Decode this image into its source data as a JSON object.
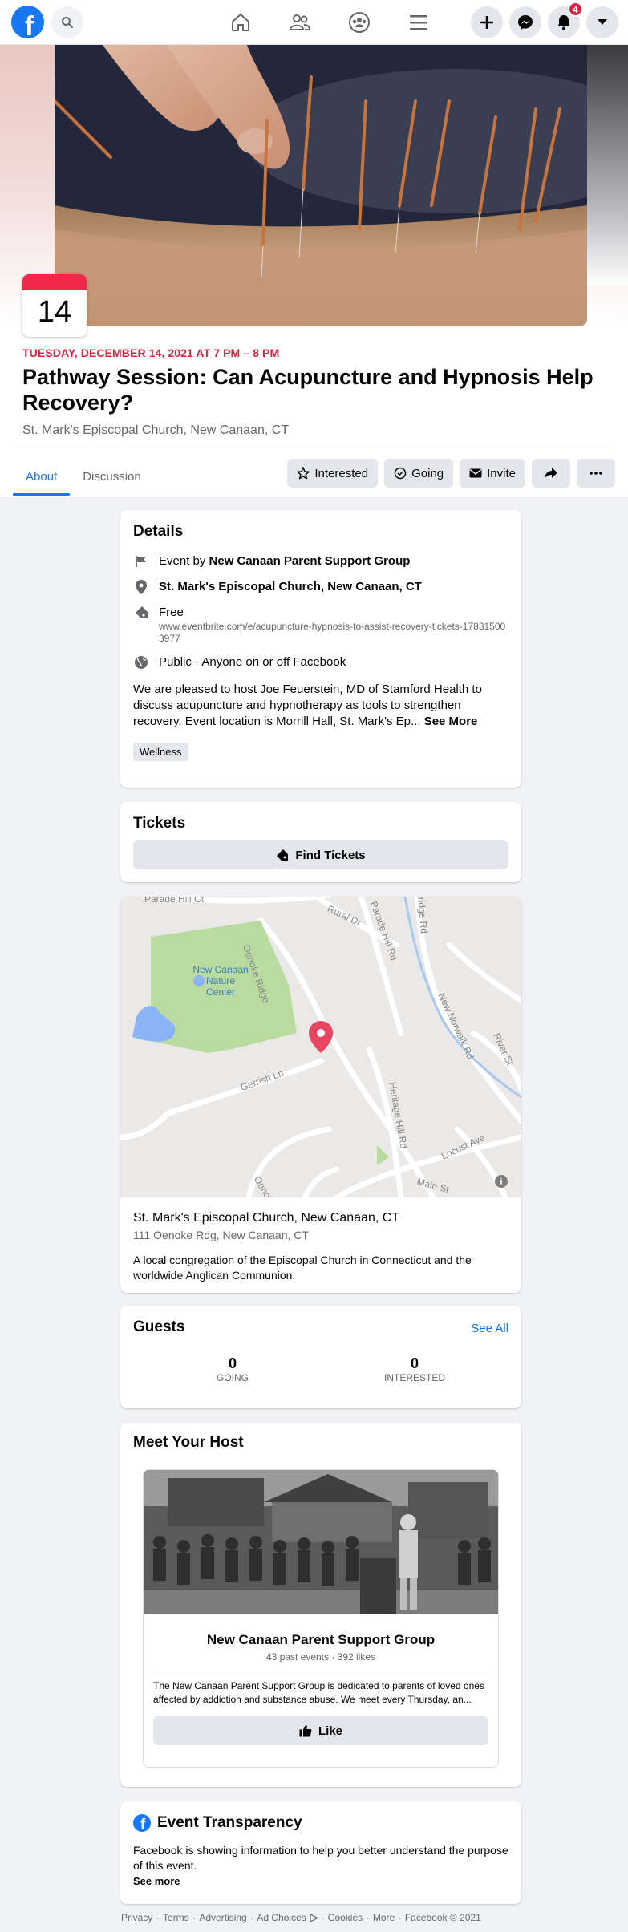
{
  "nav": {
    "logo": "f",
    "notification_count": "4"
  },
  "event": {
    "date_day": "14",
    "date_line": "TUESDAY, DECEMBER 14, 2021 AT 7 PM – 8 PM",
    "title": "Pathway Session: Can Acupuncture and Hypnosis Help Recovery?",
    "location": "St. Mark's Episcopal Church, New Canaan, CT"
  },
  "tabs": [
    {
      "label": "About",
      "active": true
    },
    {
      "label": "Discussion",
      "active": false
    }
  ],
  "actions": {
    "interested": "Interested",
    "going": "Going",
    "invite": "Invite"
  },
  "details": {
    "title": "Details",
    "event_by_prefix": "Event by ",
    "event_by": "New Canaan Parent Support Group",
    "place": "St. Mark's Episcopal Church, New Canaan, CT",
    "price": "Free",
    "ticket_url": "www.eventbrite.com/e/acupuncture-hypnosis-to-assist-recovery-tickets-178315003977",
    "privacy": "Public · Anyone on or off Facebook",
    "description": "We are pleased to host Joe Feuerstein, MD of Stamford Health to discuss acupuncture and hypnotherapy as tools to strengthen recovery. Event location is Morrill Hall, St. Mark's Ep...",
    "see_more": "See More",
    "category": "Wellness"
  },
  "tickets": {
    "title": "Tickets",
    "button": "Find Tickets"
  },
  "map": {
    "labels": {
      "nature_center": "New Canaan Nature Center",
      "oenoke": "Oenoke Ridge",
      "rural": "Rural Dr",
      "parade": "Parade Hill Rd",
      "ridge": "ridge Rd",
      "new_norwalk": "New Norwalk Rd",
      "river": "River St",
      "gerrish": "Gerrish Ln",
      "heritage": "Heritage Hill Rd",
      "locust": "Locust Ave",
      "main": "Main St",
      "oenoke2": "Oenoi",
      "parade_top": "Parade Hill Ct"
    },
    "venue_name": "St. Mark's Episcopal Church, New Canaan, CT",
    "venue_address": "111 Oenoke Rdg, New Canaan, CT",
    "venue_desc": "A local congregation of the Episcopal Church in Connecticut and the worldwide Anglican Communion."
  },
  "guests": {
    "title": "Guests",
    "see_all": "See All",
    "going_count": "0",
    "going_label": "GOING",
    "interested_count": "0",
    "interested_label": "INTERESTED"
  },
  "host": {
    "title": "Meet Your Host",
    "name": "New Canaan Parent Support Group",
    "stats": "43 past events · 392 likes",
    "desc": "The New Canaan Parent Support Group is dedicated to parents of loved ones affected by addiction and substance abuse. We meet every Thursday, an...",
    "like": "Like"
  },
  "transparency": {
    "title": "Event Transparency",
    "text": "Facebook is showing information to help you better understand the purpose of this event.",
    "see_more": "See more"
  },
  "footer": {
    "privacy": "Privacy",
    "terms": "Terms",
    "advertising": "Advertising",
    "ad_choices": "Ad Choices",
    "cookies": "Cookies",
    "more": "More",
    "copyright": "Facebook © 2021"
  },
  "colors": {
    "accent": "#1877f2",
    "date_red": "#e41e3f",
    "map_pin": "#ea4560",
    "park_green": "#b9dba0"
  }
}
